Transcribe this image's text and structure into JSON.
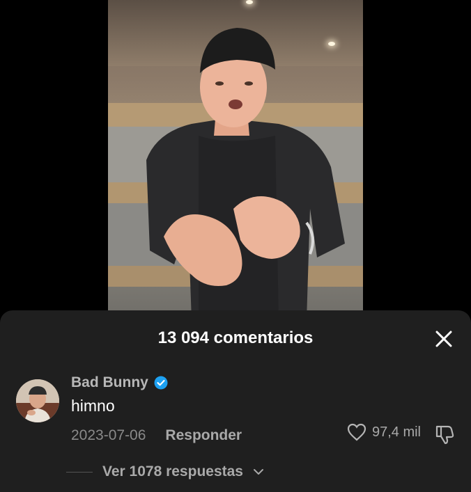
{
  "comments_panel": {
    "title": "13 094 comentarios",
    "close_icon": "close-icon"
  },
  "comment": {
    "username": "Bad Bunny",
    "verified_icon": "verified-badge-icon",
    "text": "himno",
    "date": "2023-07-06",
    "reply_label": "Responder",
    "likes": "97,4 mil",
    "like_icon": "heart-icon",
    "dislike_icon": "dislike-icon",
    "view_replies_label": "Ver 1078 respuestas",
    "view_replies_icon": "chevron-down-icon"
  },
  "colors": {
    "sheet_background": "#1f1f1f",
    "verified_badge": "#1da1f2",
    "primary_text": "#ffffff",
    "secondary_text": "#a9a9a9"
  }
}
